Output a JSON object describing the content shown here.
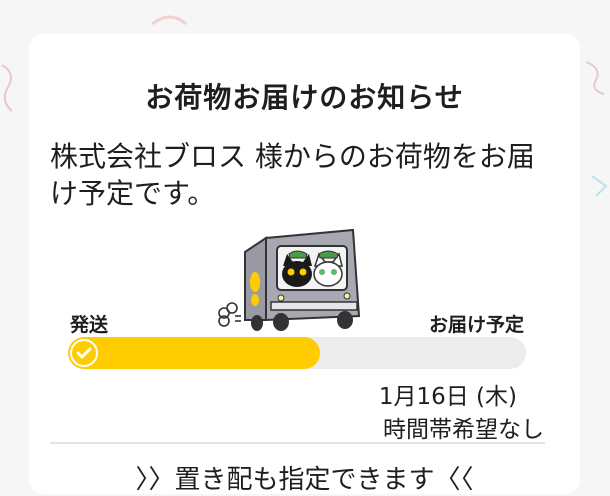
{
  "card": {
    "title": "お荷物お届けのお知らせ",
    "message": "株式会社ブロス 様からのお荷物をお届け予定です。"
  },
  "progress": {
    "start_label": "発送",
    "end_label": "お届け予定",
    "fraction": 0.55,
    "fill_color": "#ffcc00",
    "track_color": "#ececec"
  },
  "delivery": {
    "date": "1月16日 (木)",
    "time_slot": "時間帯希望なし"
  },
  "note": "〉〉置き配も指定できます〈〈"
}
